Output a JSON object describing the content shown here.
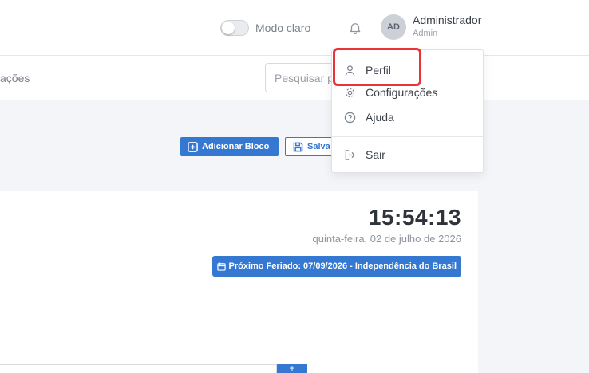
{
  "header": {
    "theme_toggle_label": "Modo claro",
    "user": {
      "initials": "AD",
      "name": "Administrador",
      "role": "Admin"
    }
  },
  "subheader": {
    "breadcrumb": "ações",
    "search_placeholder": "Pesquisar p"
  },
  "toolbar": {
    "add_block_label": "Adicionar Bloco",
    "save_label": "Salva"
  },
  "widget": {
    "time": "15:54:13",
    "date": "quinta-feira, 02 de julho de 2026",
    "holiday": "Próximo Feriado: 07/09/2026 - Independência do Brasil",
    "input_button_icon": "+"
  },
  "user_menu": {
    "items": [
      {
        "label": "Perfil",
        "icon": "user-icon"
      },
      {
        "label": "Configurações",
        "icon": "gear-icon"
      },
      {
        "label": "Ajuda",
        "icon": "help-icon"
      },
      {
        "label": "Sair",
        "icon": "logout-icon"
      }
    ],
    "highlight_color": "#e8333b"
  },
  "colors": {
    "accent": "#3478d2",
    "background": "#f4f5f8"
  }
}
